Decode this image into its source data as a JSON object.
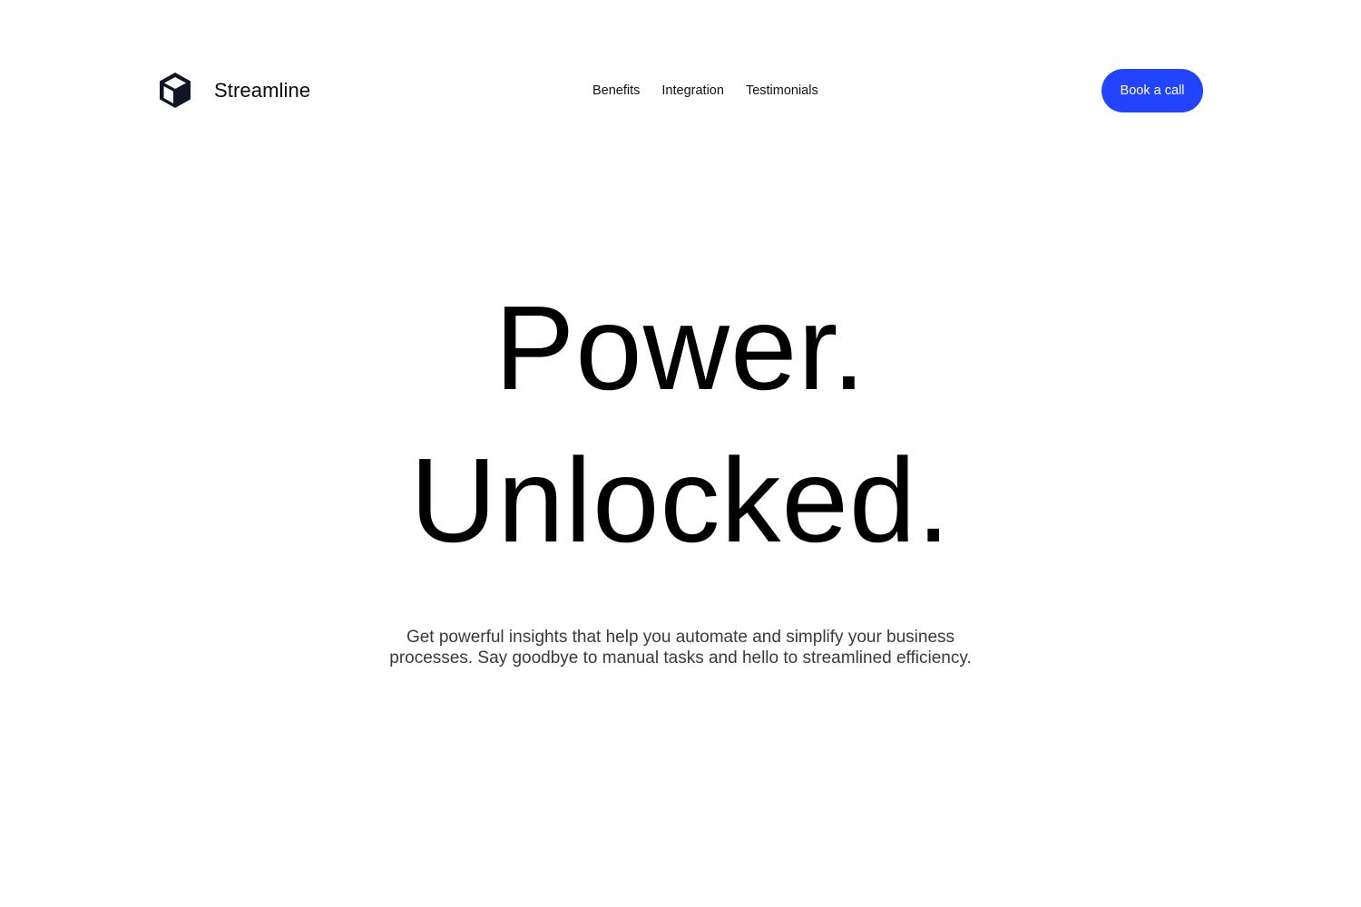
{
  "header": {
    "brand_name": "Streamline",
    "logo_icon": "cube-icon",
    "nav": [
      {
        "label": "Benefits"
      },
      {
        "label": "Integration"
      },
      {
        "label": "Testimonials"
      }
    ],
    "cta_label": "Book a call"
  },
  "hero": {
    "title_line1": "Power.",
    "title_line2": "Unlocked.",
    "subtitle": "Get powerful insights that help you automate and simplify your business processes. Say goodbye to manual tasks and hello to streamlined efficiency."
  },
  "colors": {
    "accent": "#2244ff",
    "text": "#000000",
    "muted_text": "#3a3a3a",
    "background": "#ffffff"
  }
}
